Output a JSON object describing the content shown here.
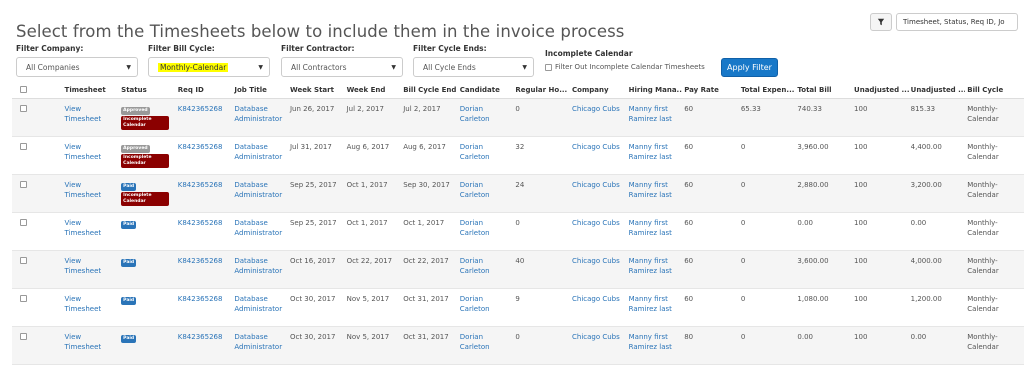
{
  "page": {
    "title": "Select from the Timesheets below to include them in the invoice process"
  },
  "columns_select": {
    "value": "Timesheet, Status, Req ID, Jo"
  },
  "filters": {
    "company": {
      "label": "Filter Company:",
      "value": "All Companies"
    },
    "bill_cycle": {
      "label": "Filter Bill Cycle:",
      "value": "Monthly-Calendar"
    },
    "contractor": {
      "label": "Filter Contractor:",
      "value": "All Contractors"
    },
    "cycle_ends": {
      "label": "Filter Cycle Ends:",
      "value": "All Cycle Ends"
    },
    "incomplete": {
      "label": "Incomplete Calendar",
      "checkbox_label": "Filter Out Incomplete Calendar Timesheets"
    },
    "apply_label": "Apply Filter"
  },
  "table": {
    "headers": [
      "",
      "Timesheet",
      "Status",
      "Req ID",
      "Job Title",
      "Week Start",
      "Week End",
      "Bill Cycle End",
      "Candidate",
      "Regular Ho...",
      "Company",
      "Hiring Mana...",
      "Pay Rate",
      "Total Expen...",
      "Total Bill",
      "Unadjusted ...",
      "Unadjusted ...",
      "Bill Cycle"
    ],
    "rows": [
      {
        "timesheet": "View Timesheet",
        "status": "Approved",
        "incomplete": "Incomplete Calendar",
        "req_id": "K842365268",
        "job": "Database Administrator",
        "week_start": "Jun 26, 2017",
        "week_end": "Jul 2, 2017",
        "cycle_end": "Jul 2, 2017",
        "candidate": "Dorian Carleton",
        "reg_hours": "0",
        "company": "Chicago Cubs",
        "manager": "Manny first Ramirez last",
        "pay_rate": "60",
        "total_exp": "65.33",
        "total_bill": "740.33",
        "unadj1": "100",
        "unadj2": "815.33",
        "bill_cycle": "Monthly-Calendar"
      },
      {
        "timesheet": "View Timesheet",
        "status": "Approved",
        "incomplete": "Incomplete Calendar",
        "req_id": "K842365268",
        "job": "Database Administrator",
        "week_start": "Jul 31, 2017",
        "week_end": "Aug 6, 2017",
        "cycle_end": "Aug 6, 2017",
        "candidate": "Dorian Carleton",
        "reg_hours": "32",
        "company": "Chicago Cubs",
        "manager": "Manny first Ramirez last",
        "pay_rate": "60",
        "total_exp": "0",
        "total_bill": "3,960.00",
        "unadj1": "100",
        "unadj2": "4,400.00",
        "bill_cycle": "Monthly-Calendar"
      },
      {
        "timesheet": "View Timesheet",
        "status": "Paid",
        "incomplete": "Incomplete Calendar",
        "req_id": "K842365268",
        "job": "Database Administrator",
        "week_start": "Sep 25, 2017",
        "week_end": "Oct 1, 2017",
        "cycle_end": "Sep 30, 2017",
        "candidate": "Dorian Carleton",
        "reg_hours": "24",
        "company": "Chicago Cubs",
        "manager": "Manny first Ramirez last",
        "pay_rate": "60",
        "total_exp": "0",
        "total_bill": "2,880.00",
        "unadj1": "100",
        "unadj2": "3,200.00",
        "bill_cycle": "Monthly-Calendar"
      },
      {
        "timesheet": "View Timesheet",
        "status": "Paid",
        "incomplete": "",
        "req_id": "K842365268",
        "job": "Database Administrator",
        "week_start": "Sep 25, 2017",
        "week_end": "Oct 1, 2017",
        "cycle_end": "Oct 1, 2017",
        "candidate": "Dorian Carleton",
        "reg_hours": "0",
        "company": "Chicago Cubs",
        "manager": "Manny first Ramirez last",
        "pay_rate": "60",
        "total_exp": "0",
        "total_bill": "0.00",
        "unadj1": "100",
        "unadj2": "0.00",
        "bill_cycle": "Monthly-Calendar"
      },
      {
        "timesheet": "View Timesheet",
        "status": "Paid",
        "incomplete": "",
        "req_id": "K842365268",
        "job": "Database Administrator",
        "week_start": "Oct 16, 2017",
        "week_end": "Oct 22, 2017",
        "cycle_end": "Oct 22, 2017",
        "candidate": "Dorian Carleton",
        "reg_hours": "40",
        "company": "Chicago Cubs",
        "manager": "Manny first Ramirez last",
        "pay_rate": "60",
        "total_exp": "0",
        "total_bill": "3,600.00",
        "unadj1": "100",
        "unadj2": "4,000.00",
        "bill_cycle": "Monthly-Calendar"
      },
      {
        "timesheet": "View Timesheet",
        "status": "Paid",
        "incomplete": "",
        "req_id": "K842365268",
        "job": "Database Administrator",
        "week_start": "Oct 30, 2017",
        "week_end": "Nov 5, 2017",
        "cycle_end": "Oct 31, 2017",
        "candidate": "Dorian Carleton",
        "reg_hours": "9",
        "company": "Chicago Cubs",
        "manager": "Manny first Ramirez last",
        "pay_rate": "60",
        "total_exp": "0",
        "total_bill": "1,080.00",
        "unadj1": "100",
        "unadj2": "1,200.00",
        "bill_cycle": "Monthly-Calendar"
      },
      {
        "timesheet": "View Timesheet",
        "status": "Paid",
        "incomplete": "",
        "req_id": "K842365268",
        "job": "Database Administrator",
        "week_start": "Oct 30, 2017",
        "week_end": "Nov 5, 2017",
        "cycle_end": "Oct 31, 2017",
        "candidate": "Dorian Carleton",
        "reg_hours": "0",
        "company": "Chicago Cubs",
        "manager": "Manny first Ramirez last",
        "pay_rate": "80",
        "total_exp": "0",
        "total_bill": "0.00",
        "unadj1": "100",
        "unadj2": "0.00",
        "bill_cycle": "Monthly-Calendar"
      }
    ]
  },
  "colors": {
    "accent": "#1878c8",
    "link": "#2a74b8",
    "approved": "#999999",
    "paid": "#2a74b8",
    "incomplete": "#8b0000",
    "highlight": "#ffff00"
  },
  "icons": {
    "column_toggle": "filter-icon",
    "dropdown": "chevron-down-icon"
  }
}
